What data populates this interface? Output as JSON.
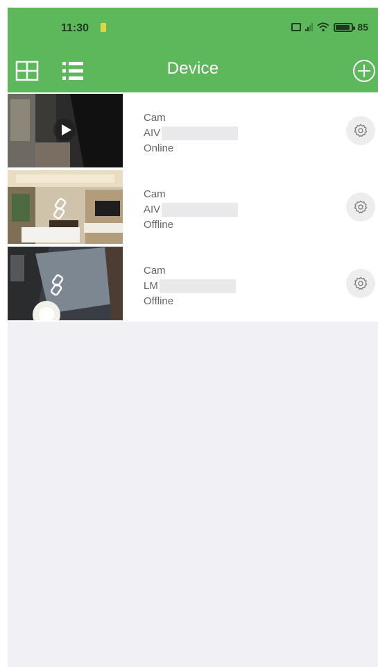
{
  "status_bar": {
    "time": "11:30",
    "battery": "85"
  },
  "toolbar": {
    "title": "Device"
  },
  "devices": [
    {
      "name": "Cam",
      "id_prefix": "AIV",
      "status": "Online"
    },
    {
      "name": "Cam",
      "id_prefix": "AIV",
      "status": "Offline"
    },
    {
      "name": "Cam",
      "id_prefix": "LM",
      "status": "Offline"
    }
  ],
  "colors": {
    "header": "#5db85c",
    "background": "#f0f0f5",
    "row_text": "#666666"
  },
  "icons": {
    "grid_view": "grid-view-icon",
    "list_view": "list-view-icon",
    "add": "add-device-icon",
    "settings": "gear-icon",
    "play": "play-icon"
  }
}
